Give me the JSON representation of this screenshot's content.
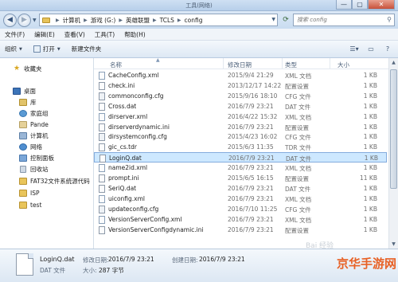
{
  "window": {
    "title": "工具(网络)",
    "buttons": {
      "minimize": "—",
      "maximize": "▢",
      "close": "✕"
    }
  },
  "address": {
    "breadcrumbs": [
      "计算机",
      "游戏 (G:)",
      "英雄联盟",
      "TCLS",
      "config"
    ],
    "search_placeholder": "搜索 config"
  },
  "menu": [
    "文件(F)",
    "编辑(E)",
    "查看(V)",
    "工具(T)",
    "帮助(H)"
  ],
  "toolbar": {
    "organize": "组织",
    "open": "打开",
    "new_folder": "新建文件夹"
  },
  "nav": {
    "favorites": "收藏夹",
    "desktop": "桌面",
    "library": "库",
    "homegroup": "家庭组",
    "user": "Pande",
    "computer": "计算机",
    "network": "网络",
    "control_panel": "控制面板",
    "recycle": "回收站",
    "folders": [
      "FAT32文件系统源代码",
      "ISP",
      "test"
    ]
  },
  "columns": {
    "name": "名称",
    "date": "修改日期",
    "type": "类型",
    "size": "大小"
  },
  "files": [
    {
      "name": "CacheConfig.xml",
      "date": "2015/9/4 21:29",
      "type": "XML 文档",
      "size": "1 KB",
      "kind": "xml"
    },
    {
      "name": "check.ini",
      "date": "2013/12/17 14:22",
      "type": "配置设置",
      "size": "1 KB",
      "kind": "ini"
    },
    {
      "name": "commonconfig.cfg",
      "date": "2015/9/16 18:10",
      "type": "CFG 文件",
      "size": "1 KB",
      "kind": "cfg"
    },
    {
      "name": "Cross.dat",
      "date": "2016/7/9 23:21",
      "type": "DAT 文件",
      "size": "1 KB",
      "kind": "dat"
    },
    {
      "name": "dirserver.xml",
      "date": "2016/4/22 15:32",
      "type": "XML 文档",
      "size": "1 KB",
      "kind": "xml"
    },
    {
      "name": "dirserverdynamic.ini",
      "date": "2016/7/9 23:21",
      "type": "配置设置",
      "size": "1 KB",
      "kind": "ini"
    },
    {
      "name": "dirsystemconfig.cfg",
      "date": "2015/4/23 16:02",
      "type": "CFG 文件",
      "size": "1 KB",
      "kind": "cfg"
    },
    {
      "name": "gic_cs.tdr",
      "date": "2015/6/3 11:35",
      "type": "TDR 文件",
      "size": "1 KB",
      "kind": "dat"
    },
    {
      "name": "LoginQ.dat",
      "date": "2016/7/9 23:21",
      "type": "DAT 文件",
      "size": "1 KB",
      "kind": "dat"
    },
    {
      "name": "name2id.xml",
      "date": "2016/7/9 23:21",
      "type": "XML 文档",
      "size": "1 KB",
      "kind": "xml"
    },
    {
      "name": "prompt.ini",
      "date": "2015/6/5 16:15",
      "type": "配置设置",
      "size": "11 KB",
      "kind": "ini"
    },
    {
      "name": "SeriQ.dat",
      "date": "2016/7/9 23:21",
      "type": "DAT 文件",
      "size": "1 KB",
      "kind": "dat"
    },
    {
      "name": "uiconfig.xml",
      "date": "2016/7/9 23:21",
      "type": "XML 文档",
      "size": "1 KB",
      "kind": "xml"
    },
    {
      "name": "updateconfig.cfg",
      "date": "2016/7/10 11:25",
      "type": "CFG 文件",
      "size": "1 KB",
      "kind": "cfg"
    },
    {
      "name": "VersionServerConfig.xml",
      "date": "2016/7/9 23:21",
      "type": "XML 文档",
      "size": "1 KB",
      "kind": "xml"
    },
    {
      "name": "VersionServerConfigdynamic.ini",
      "date": "2016/7/9 23:21",
      "type": "配置设置",
      "size": "1 KB",
      "kind": "ini"
    }
  ],
  "selected_index": 8,
  "details": {
    "name": "LoginQ.dat",
    "modified_label": "修改日期:",
    "modified": "2016/7/9 23:21",
    "created_label": "创建日期:",
    "created": "2016/7/9 23:21",
    "type": "DAT 文件",
    "size_label": "大小:",
    "size": "287 字节"
  },
  "watermark": {
    "brand": "京华手游网",
    "baidu": "Bai 经验"
  },
  "colors": {
    "selection": "#cde8ff",
    "selection_border": "#84acdd",
    "watermark": "#e85a1a"
  }
}
